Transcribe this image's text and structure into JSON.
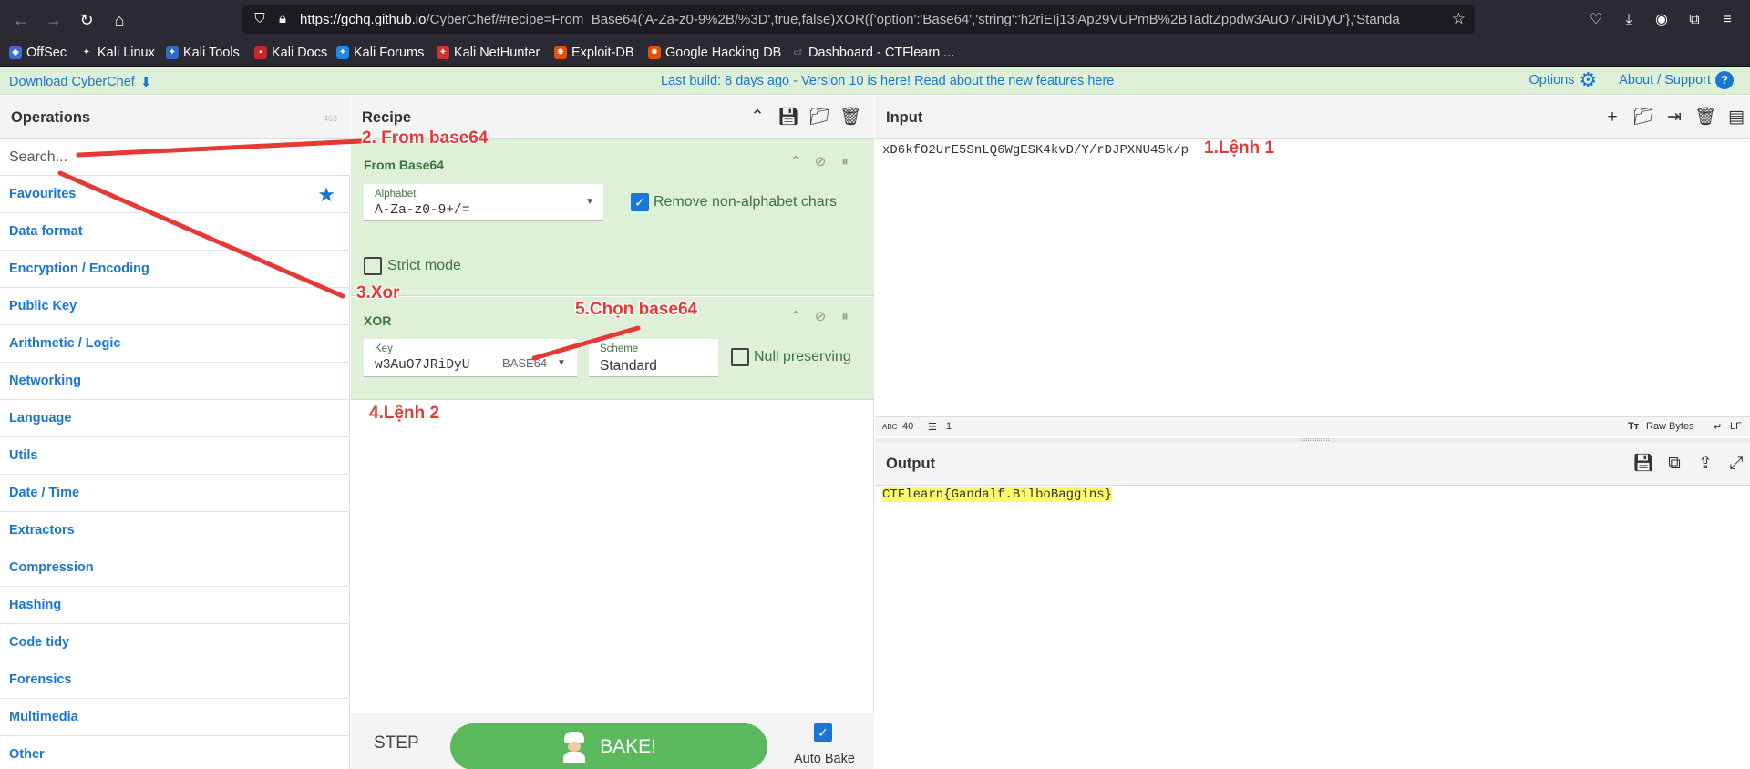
{
  "browser": {
    "url_host": "https://gchq.github.io",
    "url_path": "/CyberChef/#recipe=From_Base64('A-Za-z0-9%2B/%3D',true,false)XOR({'option':'Base64','string':'h2riEIj13iAp29VUPmB%2BTadtZppdw3AuO7JRiDyU'},'Standa",
    "bookmarks": [
      "OffSec",
      "Kali Linux",
      "Kali Tools",
      "Kali Docs",
      "Kali Forums",
      "Kali NetHunter",
      "Exploit-DB",
      "Google Hacking DB",
      "Dashboard - CTFlearn ..."
    ]
  },
  "banner": {
    "download": "Download CyberChef",
    "center_text": "Last build: 8 days ago - Version 10 is here! Read about the new features ",
    "center_link": "here",
    "options": "Options",
    "about": "About / Support",
    "about_icon": "?"
  },
  "operations": {
    "title": "Operations",
    "count": "463",
    "search_placeholder": "Search...",
    "categories": [
      "Favourites",
      "Data format",
      "Encryption / Encoding",
      "Public Key",
      "Arithmetic / Logic",
      "Networking",
      "Language",
      "Utils",
      "Date / Time",
      "Extractors",
      "Compression",
      "Hashing",
      "Code tidy",
      "Forensics",
      "Multimedia",
      "Other"
    ]
  },
  "recipe": {
    "title": "Recipe",
    "from_base64": {
      "title": "From Base64",
      "alphabet_label": "Alphabet",
      "alphabet_value": "A-Za-z0-9+/=",
      "remove_nonalpha_label": "Remove non-alphabet chars",
      "remove_nonalpha_checked": true,
      "strict_label": "Strict mode",
      "strict_checked": false
    },
    "xor": {
      "title": "XOR",
      "key_label": "Key",
      "key_value": "w3AuO7JRiDyU",
      "key_type": "BASE64",
      "scheme_label": "Scheme",
      "scheme_value": "Standard",
      "null_label": "Null preserving",
      "null_checked": false
    },
    "step_label": "STEP",
    "bake_label": "BAKE!",
    "autobake_label": "Auto Bake",
    "autobake_checked": true
  },
  "input": {
    "title": "Input",
    "value": "xD6kfO2UrE5SnLQ6WgESK4kvD/Y/rDJPXNU45k/p",
    "status_len": "40",
    "status_lines": "1",
    "status_raw": "Raw Bytes",
    "status_eol": "LF"
  },
  "output": {
    "title": "Output",
    "value": "CTFlearn{Gandalf.BilboBaggins}"
  },
  "annotations": {
    "a1": "1.Lệnh 1",
    "a2": "2. From base64",
    "a3": "3.Xor",
    "a4": "4.Lệnh 2",
    "a5": "5.Chọn base64"
  },
  "colors": {
    "annotation": "#e53935",
    "accent": "#1976d2",
    "op_bg": "#dff0d8",
    "bake": "#5cb85c",
    "highlight": "#fbfb6b"
  }
}
